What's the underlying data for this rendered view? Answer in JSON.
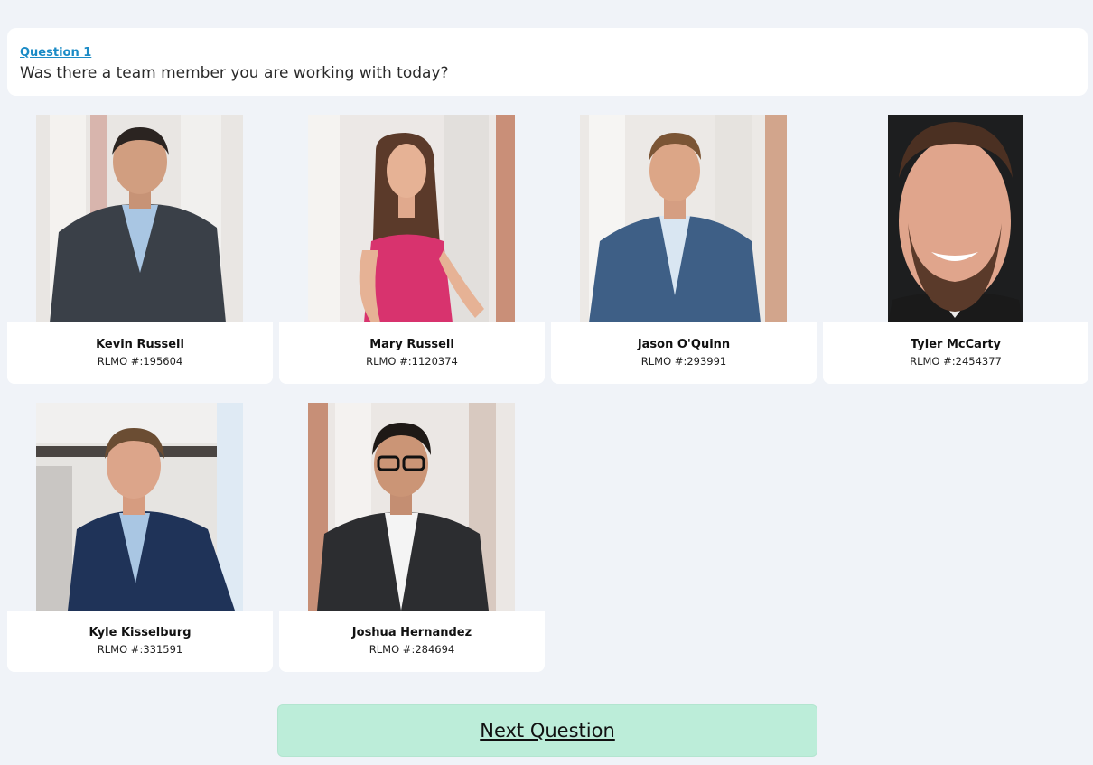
{
  "question": {
    "label": "Question 1",
    "text": "Was there a team member you are working with today?"
  },
  "members": [
    {
      "name": "Kevin Russell",
      "rlmo": "RLMO #:195604",
      "photo_icon": "person-photo"
    },
    {
      "name": "Mary Russell",
      "rlmo": "RLMO #:1120374",
      "photo_icon": "person-photo"
    },
    {
      "name": "Jason O'Quinn",
      "rlmo": "RLMO #:293991",
      "photo_icon": "person-photo"
    },
    {
      "name": "Tyler McCarty",
      "rlmo": "RLMO #:2454377",
      "photo_icon": "person-photo"
    },
    {
      "name": "Kyle Kisselburg",
      "rlmo": "RLMO #:331591",
      "photo_icon": "person-photo"
    },
    {
      "name": "Joshua Hernandez",
      "rlmo": "RLMO #:284694",
      "photo_icon": "person-photo"
    }
  ],
  "next_button": {
    "label": "Next Question"
  },
  "colors": {
    "background": "#f0f3f8",
    "question_link": "#1b8bc6",
    "next_button": "#bcedd9"
  }
}
